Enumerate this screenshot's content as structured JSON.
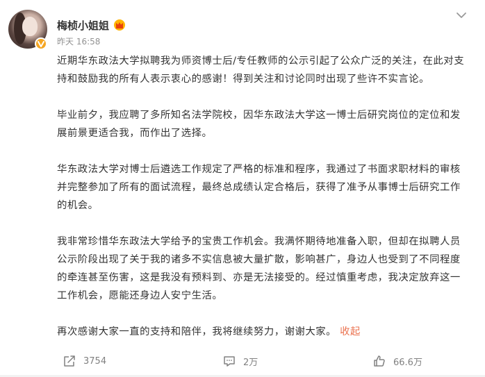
{
  "post": {
    "author": {
      "name": "梅桢小姐姐",
      "avatar_icon": "user-avatar-photo",
      "verified_icon": "verified-v-badge",
      "rank_icon": "fan-crown-badge"
    },
    "timestamp": "昨天 16:58",
    "more_icon": "chevron-down-icon",
    "paragraphs": [
      "近期华东政法大学拟聘我为师资博士后/专任教师的公示引起了公众广泛的关注，在此对支持和鼓励我的所有人表示衷心的感谢！得到关注和讨论同时出现了些许不实言论。",
      "毕业前夕，我应聘了多所知名法学院校，因华东政法大学这一博士后研究岗位的定位和发展前景更适合我，而作出了选择。",
      "华东政法大学对博士后遴选工作规定了严格的标准和程序，我通过了书面求职材料的审核并完整参加了所有的面试流程，最终总成绩认定合格后，获得了准予从事博士后研究工作的机会。",
      "我非常珍惜华东政法大学给予的宝贵工作机会。我满怀期待地准备入职，但却在拟聘人员公示阶段出现了关于我的诸多不实信息被大量扩散，影响甚广，身边人也受到了不同程度的牵连甚至伤害，这是我没有预料到、亦是无法接受的。经过慎重考虑，我决定放弃这一工作机会，愿能还身边人安宁生活。",
      "再次感谢大家一直的支持和陪伴，我将继续努力，谢谢大家。"
    ],
    "collapse_label": "收起",
    "accent_color": "#eb7350"
  },
  "actions": {
    "repost": {
      "icon": "share-icon",
      "count": "3754"
    },
    "comment": {
      "icon": "comment-icon",
      "count": "2万"
    },
    "like": {
      "icon": "thumbs-up-icon",
      "count": "66.6万"
    }
  }
}
